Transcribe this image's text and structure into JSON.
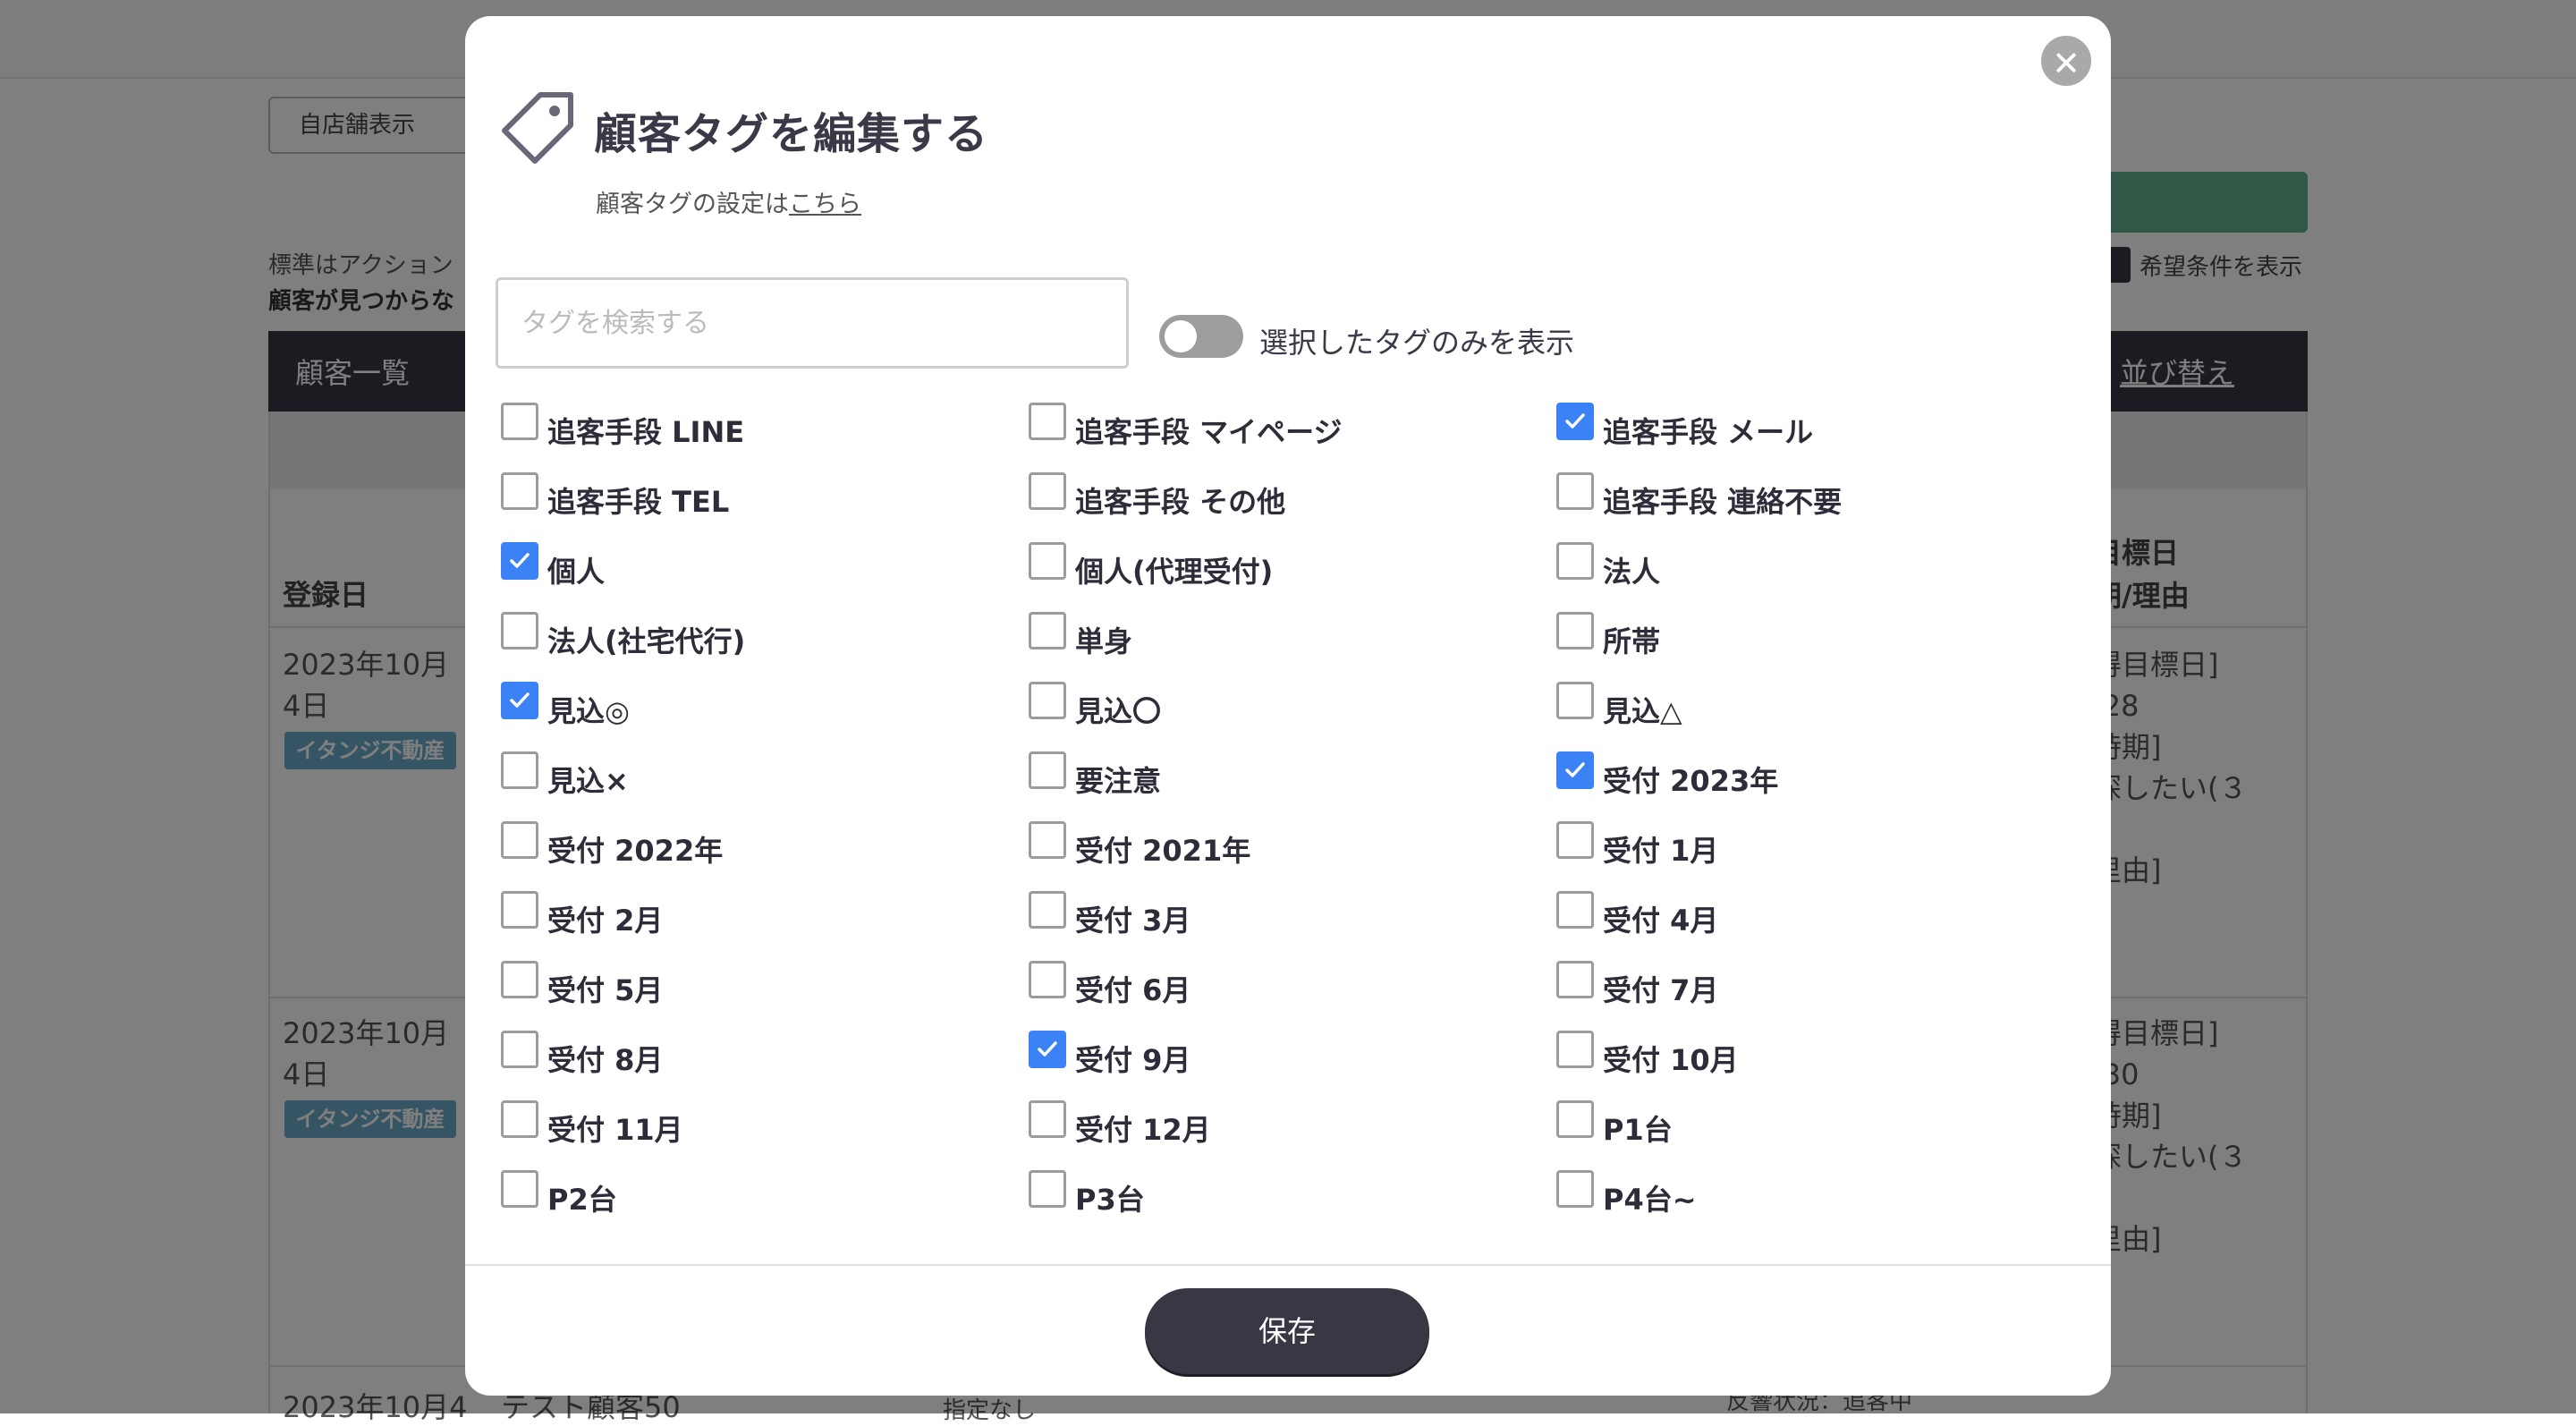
{
  "background": {
    "store_button": "自店舗表示",
    "note_line1": "標準はアクション",
    "note_line2": "顧客が見つからな",
    "condition_label": "希望条件を表示",
    "table_title": "顧客一覧",
    "sort_label": "並び替え",
    "col_registered": "登録日",
    "col_right": "目標日\n期/理由",
    "rows": [
      {
        "date": "2023年10月4日",
        "shop": "イタンジ不動産",
        "right": "得目標日]\n/28\n時期]\n探したい(３\n)\n里由]"
      },
      {
        "date": "2023年10月4日",
        "shop": "イタンジ不動産",
        "right": "得目標日]\n/30\n時期]\n探したい(３\n)\n里由]"
      }
    ],
    "last_row_date": "2023年10月4",
    "last_row_name": "テスト顧客50",
    "last_row_select": "指定なし",
    "last_row_status": "反響状況：追客中"
  },
  "modal": {
    "title": "顧客タグを編集する",
    "subtitle_prefix": "顧客タグの設定は",
    "subtitle_link": "こちら",
    "search_placeholder": "タグを検索する",
    "search_value": "",
    "toggle_label": "選択したタグのみを表示",
    "toggle_on": false,
    "save_label": "保存",
    "close_symbol": "✕",
    "accent_color": "#3b82f6",
    "tags": [
      {
        "label": "追客手段 LINE",
        "checked": false
      },
      {
        "label": "追客手段 マイページ",
        "checked": false
      },
      {
        "label": "追客手段 メール",
        "checked": true
      },
      {
        "label": "追客手段 TEL",
        "checked": false
      },
      {
        "label": "追客手段 その他",
        "checked": false
      },
      {
        "label": "追客手段 連絡不要",
        "checked": false
      },
      {
        "label": "個人",
        "checked": true
      },
      {
        "label": "個人(代理受付)",
        "checked": false
      },
      {
        "label": "法人",
        "checked": false
      },
      {
        "label": "法人(社宅代行)",
        "checked": false
      },
      {
        "label": "単身",
        "checked": false
      },
      {
        "label": "所帯",
        "checked": false
      },
      {
        "label": "見込◎",
        "checked": true
      },
      {
        "label": "見込〇",
        "checked": false
      },
      {
        "label": "見込△",
        "checked": false
      },
      {
        "label": "見込×",
        "checked": false
      },
      {
        "label": "要注意",
        "checked": false
      },
      {
        "label": "受付 2023年",
        "checked": true
      },
      {
        "label": "受付 2022年",
        "checked": false
      },
      {
        "label": "受付 2021年",
        "checked": false
      },
      {
        "label": "受付 1月",
        "checked": false
      },
      {
        "label": "受付 2月",
        "checked": false
      },
      {
        "label": "受付 3月",
        "checked": false
      },
      {
        "label": "受付 4月",
        "checked": false
      },
      {
        "label": "受付 5月",
        "checked": false
      },
      {
        "label": "受付 6月",
        "checked": false
      },
      {
        "label": "受付 7月",
        "checked": false
      },
      {
        "label": "受付 8月",
        "checked": false
      },
      {
        "label": "受付 9月",
        "checked": true
      },
      {
        "label": "受付 10月",
        "checked": false
      },
      {
        "label": "受付 11月",
        "checked": false
      },
      {
        "label": "受付 12月",
        "checked": false
      },
      {
        "label": "P1台",
        "checked": false
      },
      {
        "label": "P2台",
        "checked": false
      },
      {
        "label": "P3台",
        "checked": false
      },
      {
        "label": "P4台~",
        "checked": false
      }
    ]
  }
}
